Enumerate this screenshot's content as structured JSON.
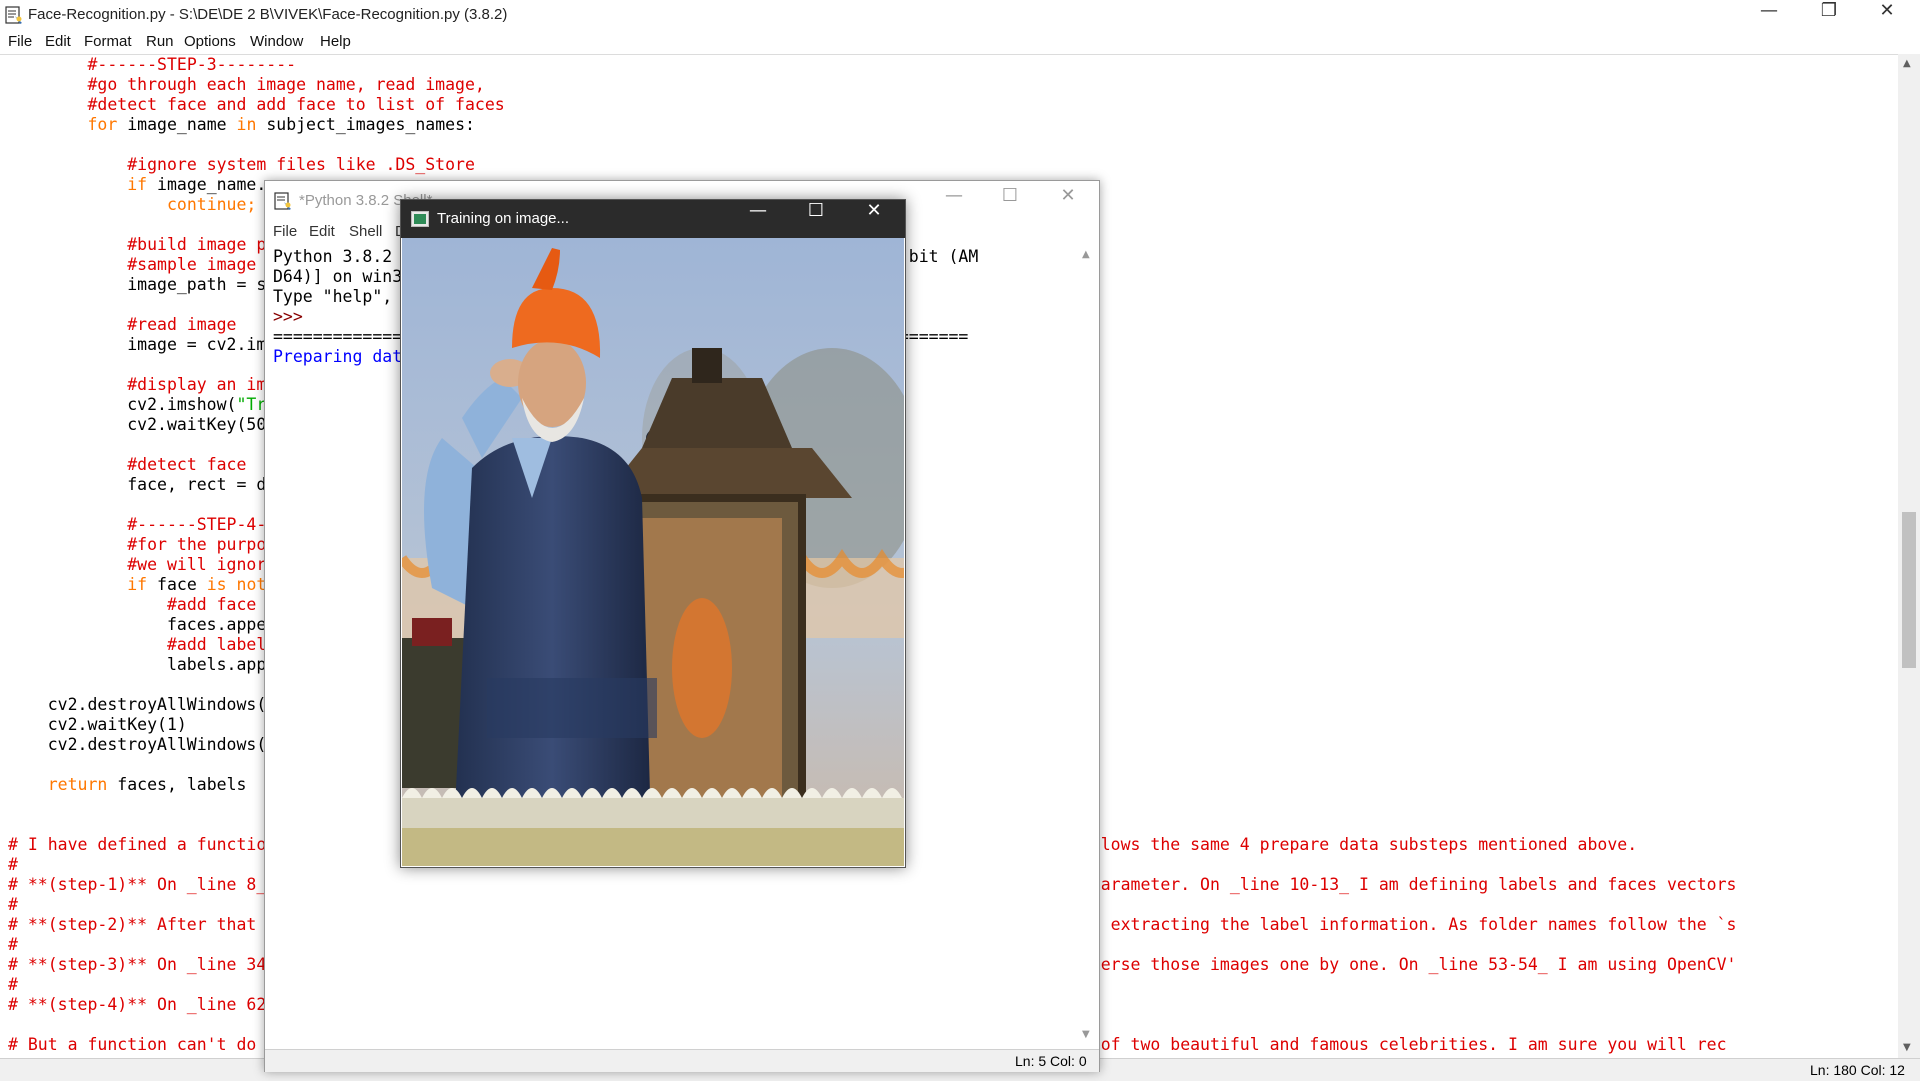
{
  "editor": {
    "title": "Face-Recognition.py - S:\\DE\\DE 2 B\\VIVEK\\Face-Recognition.py (3.8.2)",
    "menu": [
      "File",
      "Edit",
      "Format",
      "Run",
      "Options",
      "Window",
      "Help"
    ],
    "code_lines": [
      [
        {
          "t": "        "
        },
        {
          "t": "#------STEP-3--------",
          "c": "cm"
        }
      ],
      [
        {
          "t": "        "
        },
        {
          "t": "#go through each image name, read image,",
          "c": "cm"
        }
      ],
      [
        {
          "t": "        "
        },
        {
          "t": "#detect face and add face to list of faces",
          "c": "cm"
        }
      ],
      [
        {
          "t": "        "
        },
        {
          "t": "for",
          "c": "kw"
        },
        {
          "t": " image_name "
        },
        {
          "t": "in",
          "c": "kw"
        },
        {
          "t": " subject_images_names:"
        }
      ],
      [
        {
          "t": ""
        }
      ],
      [
        {
          "t": "            "
        },
        {
          "t": "#ignore system files like .DS_Store",
          "c": "cm"
        }
      ],
      [
        {
          "t": "            "
        },
        {
          "t": "if",
          "c": "kw"
        },
        {
          "t": " image_name."
        }
      ],
      [
        {
          "t": "                "
        },
        {
          "t": "continue;",
          "c": "kw"
        }
      ],
      [
        {
          "t": ""
        }
      ],
      [
        {
          "t": "            "
        },
        {
          "t": "#build image p",
          "c": "cm"
        }
      ],
      [
        {
          "t": "            "
        },
        {
          "t": "#sample image",
          "c": "cm"
        }
      ],
      [
        {
          "t": "            image_path = s"
        }
      ],
      [
        {
          "t": ""
        }
      ],
      [
        {
          "t": "            "
        },
        {
          "t": "#read image",
          "c": "cm"
        }
      ],
      [
        {
          "t": "            image = cv2.im"
        }
      ],
      [
        {
          "t": ""
        }
      ],
      [
        {
          "t": "            "
        },
        {
          "t": "#display an im",
          "c": "cm"
        }
      ],
      [
        {
          "t": "            cv2.imshow("
        },
        {
          "t": "\"Tr",
          "c": "st"
        }
      ],
      [
        {
          "t": "            cv2.waitKey(50"
        }
      ],
      [
        {
          "t": ""
        }
      ],
      [
        {
          "t": "            "
        },
        {
          "t": "#detect face",
          "c": "cm"
        }
      ],
      [
        {
          "t": "            face, rect = d"
        }
      ],
      [
        {
          "t": ""
        }
      ],
      [
        {
          "t": "            "
        },
        {
          "t": "#------STEP-4-",
          "c": "cm"
        }
      ],
      [
        {
          "t": "            "
        },
        {
          "t": "#for the purpo",
          "c": "cm"
        }
      ],
      [
        {
          "t": "            "
        },
        {
          "t": "#we will ignor",
          "c": "cm"
        }
      ],
      [
        {
          "t": "            "
        },
        {
          "t": "if",
          "c": "kw"
        },
        {
          "t": " face "
        },
        {
          "t": "is not",
          "c": "kw"
        }
      ],
      [
        {
          "t": "                "
        },
        {
          "t": "#add face",
          "c": "cm"
        }
      ],
      [
        {
          "t": "                faces.appe"
        }
      ],
      [
        {
          "t": "                "
        },
        {
          "t": "#add label",
          "c": "cm"
        }
      ],
      [
        {
          "t": "                labels.app"
        }
      ],
      [
        {
          "t": ""
        }
      ],
      [
        {
          "t": "    cv2.destroyAllWindows("
        }
      ],
      [
        {
          "t": "    cv2.waitKey(1)"
        }
      ],
      [
        {
          "t": "    cv2.destroyAllWindows("
        }
      ],
      [
        {
          "t": ""
        }
      ],
      [
        {
          "t": "    "
        },
        {
          "t": "return",
          "c": "kw"
        },
        {
          "t": " faces, labels"
        }
      ],
      [
        {
          "t": ""
        }
      ],
      [
        {
          "t": ""
        }
      ],
      [
        {
          "t": "# I have defined a functio                                                                    his function follows the same 4 prepare data substeps mentioned above.",
          "c": "cm"
        }
      ],
      [
        {
          "t": "#",
          "c": "cm"
        }
      ],
      [
        {
          "t": "# **(step-1)** On _line 8_                                                                    to function as parameter. On _line 10-13_ I am defining labels and faces vectors",
          "c": "cm"
        }
      ],
      [
        {
          "t": "#",
          "c": "cm"
        }
      ],
      [
        {
          "t": "# **(step-2)** After that                                                                     n _line 27_ I am extracting the label information. As folder names follow the `s",
          "c": "cm"
        }
      ],
      [
        {
          "t": "#",
          "c": "cm"
        }
      ],
      [
        {
          "t": "# **(step-3)** On _line 34                                                                    ne 39-66_ I traverse those images one by one. On _line 53-54_ I am using OpenCV'",
          "c": "cm"
        }
      ],
      [
        {
          "t": "#",
          "c": "cm"
        }
      ],
      [
        {
          "t": "# **(step-4)** On _line 62",
          "c": "cm"
        }
      ],
      [
        {
          "t": ""
        }
      ],
      [
        {
          "t": "# But a function can't do                                                                     I have got data of two beautiful and famous celebrities. I am sure you will rec",
          "c": "cm"
        }
      ]
    ],
    "status": "Ln: 180   Col: 12"
  },
  "shell": {
    "title": "*Python 3.8.2 Shell*",
    "menu": [
      "File",
      "Edit",
      "Shell",
      "D"
    ],
    "lines": [
      {
        "t": "Python 3.8.2                                          v.1916 64 bit (AM"
      },
      {
        "t": "D64)] on win3"
      },
      {
        "t": "Type \"help\",                                          ormation."
      },
      {
        "t": ">>> ",
        "c": "prompt"
      },
      {
        "t": "=============                                        y ==============="
      },
      {
        "t": "Preparing dat",
        "c": "blue"
      }
    ],
    "status": "Ln: 5   Col: 0"
  },
  "cv_window": {
    "title": "Training on image..."
  },
  "icons": {
    "idle": "idle-python-icon",
    "opencv": "opencv-window-icon",
    "minimize": "minimize-icon",
    "maximize": "maximize-icon",
    "restore": "restore-icon",
    "close": "close-icon"
  }
}
